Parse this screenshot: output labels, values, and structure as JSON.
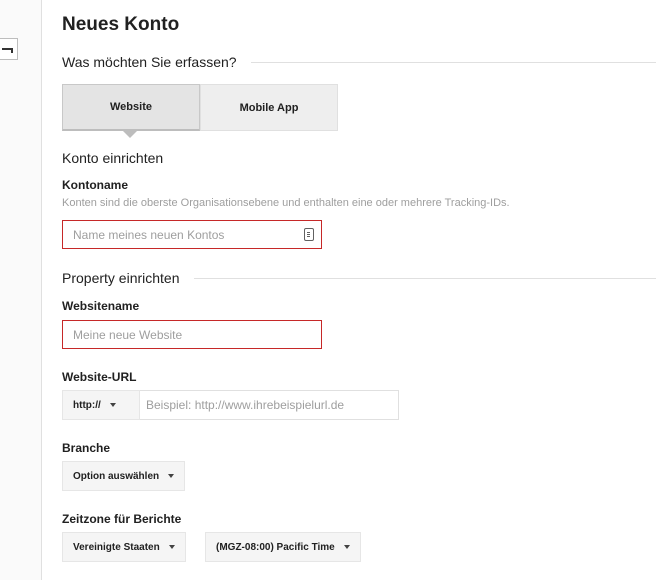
{
  "page": {
    "title": "Neues Konto"
  },
  "tracking": {
    "question": "Was möchten Sie erfassen?",
    "tabs": [
      {
        "label": "Website",
        "selected": true
      },
      {
        "label": "Mobile App",
        "selected": false
      }
    ]
  },
  "account": {
    "section_title": "Konto einrichten",
    "name_label": "Kontoname",
    "name_description": "Konten sind die oberste Organisationsebene und enthalten eine oder mehrere Tracking-IDs.",
    "name_placeholder": "Name meines neuen Kontos",
    "name_value": ""
  },
  "property": {
    "section_title": "Property einrichten",
    "website_name_label": "Websitename",
    "website_name_placeholder": "Meine neue Website",
    "website_name_value": "",
    "url_label": "Website-URL",
    "protocol_selected": "http://",
    "url_placeholder": "Beispiel: http://www.ihrebeispielurl.de",
    "url_value": "",
    "industry_label": "Branche",
    "industry_selected": "Option auswählen",
    "timezone_label": "Zeitzone für Berichte",
    "timezone_country": "Vereinigte Staaten",
    "timezone_zone": "(MGZ-08:00) Pacific Time"
  },
  "colors": {
    "error_border": "#c62828",
    "muted_text": "#9e9e9e",
    "tab_background": "#eeeeee"
  },
  "icons": {
    "account_name_field": "contact-card-icon",
    "left_rail_control": "collapse-bracket-icon"
  }
}
